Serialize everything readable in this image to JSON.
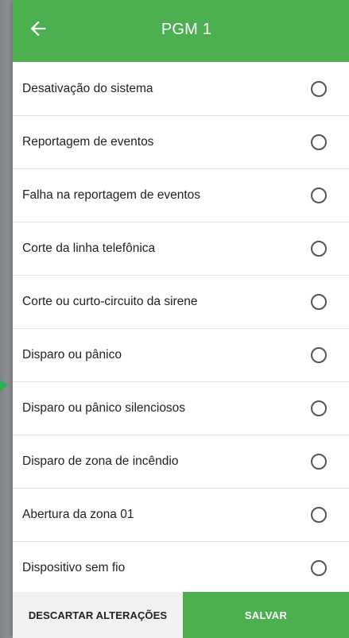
{
  "header": {
    "title": "PGM 1",
    "back_icon": "arrow-left-icon",
    "color": "#4caf50"
  },
  "items": [
    {
      "label": "Desativação do sistema",
      "selected": false
    },
    {
      "label": "Reportagem de eventos",
      "selected": false
    },
    {
      "label": "Falha na reportagem de eventos",
      "selected": false
    },
    {
      "label": "Corte da linha telefônica",
      "selected": false
    },
    {
      "label": "Corte ou curto-circuito da sirene",
      "selected": false
    },
    {
      "label": "Disparo ou pânico",
      "selected": false
    },
    {
      "label": "Disparo ou pânico silenciosos",
      "selected": false
    },
    {
      "label": "Disparo de zona de incêndio",
      "selected": false
    },
    {
      "label": "Abertura da zona 01",
      "selected": false
    },
    {
      "label": "Dispositivo sem fio",
      "selected": false
    }
  ],
  "footer": {
    "discard_label": "DESCARTAR ALTERAÇÕES",
    "save_label": "SALVAR"
  }
}
